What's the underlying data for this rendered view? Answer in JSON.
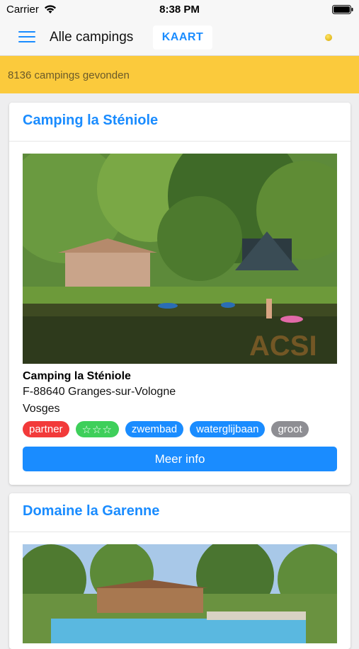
{
  "status": {
    "carrier": "Carrier",
    "time": "8:38 PM"
  },
  "nav": {
    "title": "Alle campings",
    "map_tab": "KAART"
  },
  "banner": {
    "text": "8136 campings gevonden"
  },
  "colors": {
    "accent": "#1a8cff",
    "banner": "#fbca3c",
    "partner": "#f23a3a",
    "stars": "#3ecf5a",
    "facility": "#1a8cff",
    "size": "#8e8e93"
  },
  "campings": [
    {
      "title": "Camping la Sténiole",
      "name": "Camping la Sténiole",
      "address": "F-88640  Granges-sur-Vologne",
      "region": "Vosges",
      "tags": {
        "partner": "partner",
        "stars": "☆☆☆",
        "pool": "zwembad",
        "slide": "waterglijbaan",
        "size": "groot"
      },
      "more_button": "Meer info"
    },
    {
      "title": "Domaine la Garenne"
    }
  ]
}
